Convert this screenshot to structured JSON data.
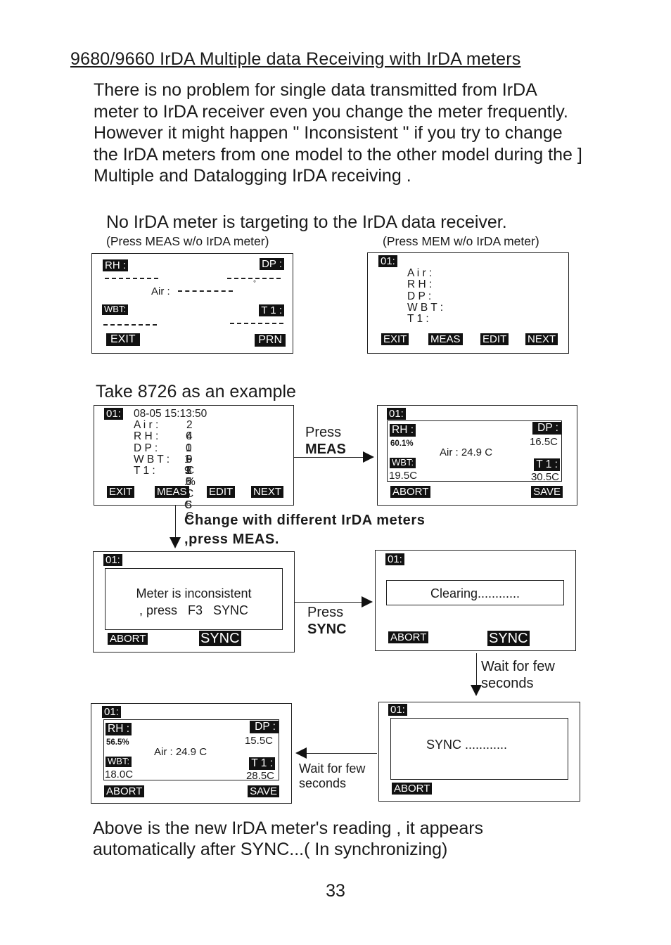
{
  "title": "9680/9660 IrDA  Multiple data Receiving with IrDA meters",
  "intro": [
    "There is no problem for single data transmitted from IrDA",
    "meter to IrDA receiver even you change the meter frequently.",
    "However it might happen \" Inconsistent \" if you try to change",
    "the IrDA meters from one model to the other model during the ]",
    "Multiple and Datalogging IrDA receiving ."
  ],
  "section1": {
    "heading": "No IrDA meter is targeting to the IrDA data receiver.",
    "left_caption": "(Press MEAS w/o IrDA meter)",
    "right_caption": "(Press MEM w/o IrDA meter)",
    "screen_a": {
      "rh": "RH :",
      "dp": "DP :",
      "air": "Air :",
      "wbt": "WBT:",
      "t1": "T 1 :",
      "degree": "°",
      "buttons": [
        "EXIT",
        "PRN"
      ]
    },
    "screen_b": {
      "index": "01:",
      "fields": [
        "A i r :",
        "R H :",
        "D P :",
        "W B T :",
        "T 1 :"
      ],
      "buttons": [
        "EXIT",
        "MEAS",
        "EDIT",
        "NEXT"
      ]
    }
  },
  "section2": {
    "heading": "Take 8726 as an example",
    "screen_c": {
      "index": "01:",
      "timestamp": "08-05 15:13:50",
      "rows": [
        {
          "label": "A i r :",
          "value": "2 4 . 9 C"
        },
        {
          "label": "R H :",
          "value": "6 0 . 1 %"
        },
        {
          "label": "D P :",
          "value": "1 6 . 5 C"
        },
        {
          "label": "W B T :",
          "value": "1 9 . 5 C"
        },
        {
          "label": "T 1 :",
          "value": "3 0 . 5 C"
        }
      ],
      "buttons": [
        "EXIT",
        "MEAS",
        "EDIT",
        "NEXT"
      ]
    },
    "press_meas": {
      "line1": "Press",
      "line2": "MEAS"
    },
    "screen_d": {
      "index": "01:",
      "rh_label": "RH :",
      "rh_value": "60.1%",
      "dp_label": "DP :",
      "dp_value": "16.5C",
      "degree": "°",
      "air": "Air : 24.9 C",
      "wbt_label": "WBT:",
      "wbt_value": "19.5C",
      "t1_label": "T 1 :",
      "t1_value": "30.5C",
      "buttons": [
        "ABORT",
        "SAVE"
      ]
    },
    "change_note": {
      "line1": "Change with different IrDA meters",
      "line2": ",press MEAS."
    },
    "screen_e": {
      "index": "01:",
      "message_line1": "Meter is inconsistent",
      "message_line2": ", press   F3   SYNC",
      "buttons": [
        "ABORT",
        "SYNC"
      ]
    },
    "press_sync": {
      "line1": "Press",
      "line2": "SYNC"
    },
    "screen_f": {
      "index": "01:",
      "message": "Clearing............",
      "buttons": [
        "ABORT",
        "SYNC"
      ]
    },
    "wait_down": {
      "line1": "Wait for few",
      "line2": "seconds"
    },
    "screen_g": {
      "index": "01:",
      "message": "SYNC ............",
      "buttons": [
        "ABORT"
      ]
    },
    "wait_left": {
      "line1": "Wait for few",
      "line2": "seconds"
    },
    "screen_h": {
      "index": "01:",
      "rh_label": "RH :",
      "rh_value": "56.5%",
      "dp_label": "DP :",
      "dp_value": "15.5C",
      "degree": "°",
      "air": "Air : 24.9 C",
      "wbt_label": "WBT:",
      "wbt_value": "18.0C",
      "t1_label": "T 1 :",
      "t1_value": "28.5C",
      "buttons": [
        "ABORT",
        "SAVE"
      ]
    }
  },
  "footer": {
    "line1": "Above is the new IrDA meter's reading , it appears",
    "line2": "automatically after SYNC...( In synchronizing)",
    "page_number": "33"
  }
}
